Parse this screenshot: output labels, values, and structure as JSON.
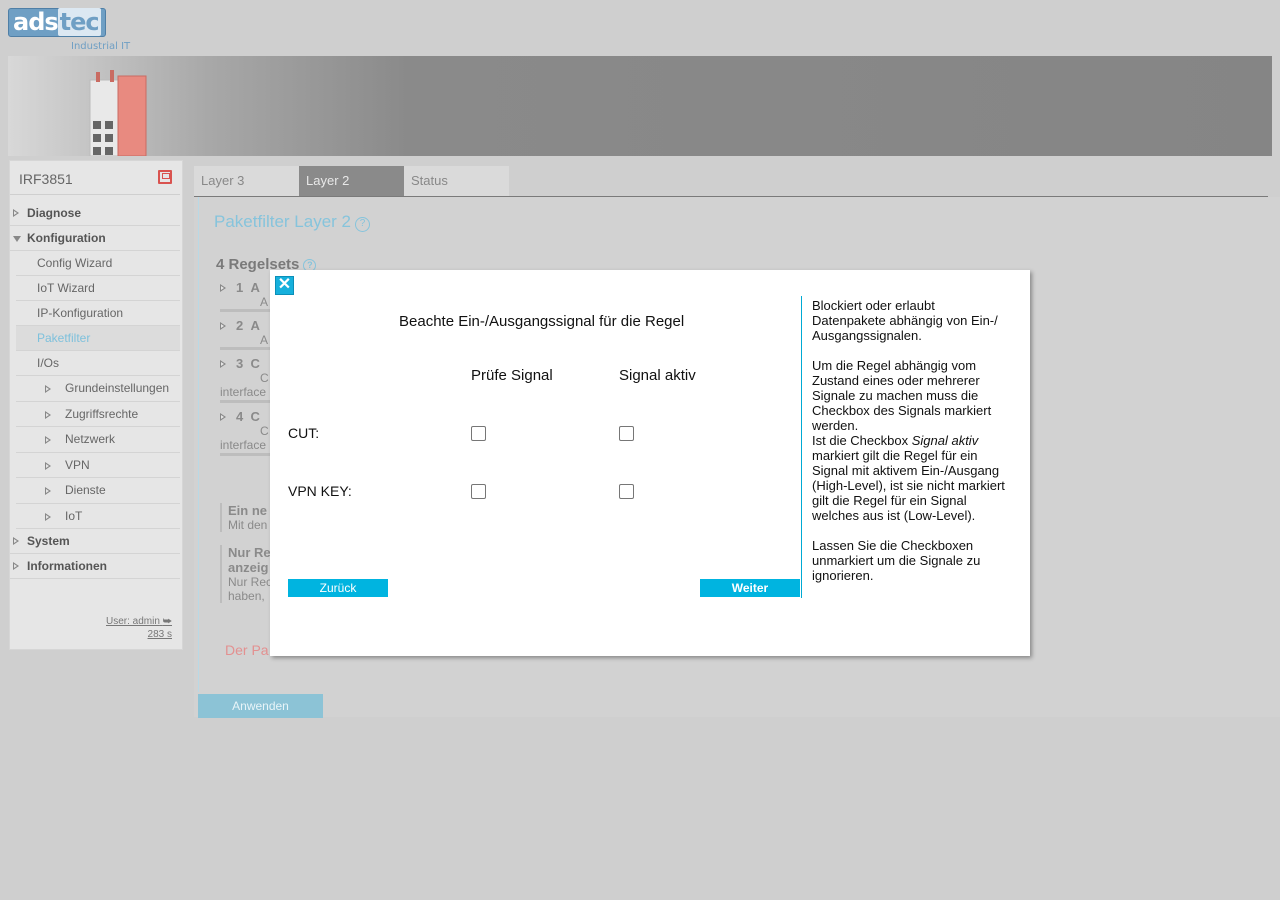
{
  "brand": {
    "logo_main": "ads",
    "logo_accent": "tec",
    "tagline": "Industrial IT"
  },
  "sidebar": {
    "device_name": "IRF3851",
    "items": [
      {
        "label": "Diagnose",
        "level": "top",
        "state": "collapsed"
      },
      {
        "label": "Konfiguration",
        "level": "top",
        "state": "expanded"
      },
      {
        "label": "Config Wizard",
        "level": "sub"
      },
      {
        "label": "IoT Wizard",
        "level": "sub"
      },
      {
        "label": "IP-Konfiguration",
        "level": "sub"
      },
      {
        "label": "Paketfilter",
        "level": "sub",
        "active": true
      },
      {
        "label": "I/Os",
        "level": "sub"
      },
      {
        "label": "Grundeinstellungen",
        "level": "subsub"
      },
      {
        "label": "Zugriffsrechte",
        "level": "subsub"
      },
      {
        "label": "Netzwerk",
        "level": "subsub"
      },
      {
        "label": "VPN",
        "level": "subsub"
      },
      {
        "label": "Dienste",
        "level": "subsub"
      },
      {
        "label": "IoT",
        "level": "subsub"
      },
      {
        "label": "System",
        "level": "top",
        "state": "collapsed"
      },
      {
        "label": "Informationen",
        "level": "top",
        "state": "collapsed"
      }
    ],
    "user": "User: admin",
    "session_time": "283 s"
  },
  "tabs": [
    {
      "label": "Layer 3",
      "active": false
    },
    {
      "label": "Layer 2",
      "active": true
    },
    {
      "label": "Status",
      "active": false
    }
  ],
  "main": {
    "title": "Paketfilter Layer 2",
    "regelsets_label": "4 Regelsets",
    "rules": [
      {
        "num": "1",
        "name": "A",
        "sub": "A"
      },
      {
        "num": "2",
        "name": "A",
        "sub": "A"
      },
      {
        "num": "3",
        "name": "C",
        "sub": "C",
        "extra": "interface"
      },
      {
        "num": "4",
        "name": "C",
        "sub": "C",
        "extra": "interface"
      }
    ],
    "info1_title": "Ein ne",
    "info1_text": "Mit den",
    "info2_title_1": "Nur Re",
    "info2_title_2": "anzeig",
    "info2_text_1": "Nur Rec",
    "info2_text_2": "haben,",
    "warning": "Der Pa",
    "apply_label": "Anwenden"
  },
  "modal": {
    "heading": "Beachte Ein-/Ausgangssignal für die Regel",
    "col_check": "Prüfe Signal",
    "col_active": "Signal aktiv",
    "signals": [
      {
        "label": "CUT:",
        "check": false,
        "active": false
      },
      {
        "label": "VPN KEY:",
        "check": false,
        "active": false
      }
    ],
    "back_label": "Zurück",
    "next_label": "Weiter",
    "help_p1": "Blockiert oder erlaubt Datenpakete abhängig von Ein-/ Ausgangssignalen.",
    "help_p2a": "Um die Regel abhängig vom Zustand eines oder mehrerer Signale zu machen muss die Checkbox des Signals markiert werden.",
    "help_p2b_pre": "Ist die Checkbox ",
    "help_p2b_em": "Signal aktiv",
    "help_p2b_post": " markiert gilt die Regel für ein Signal mit aktivem Ein-/Ausgang (High-Level), ist sie nicht markiert gilt die Regel für ein Signal welches aus ist (Low-Level).",
    "help_p3": "Lassen Sie die Checkboxen unmarkiert um die Signale zu ignorieren."
  }
}
